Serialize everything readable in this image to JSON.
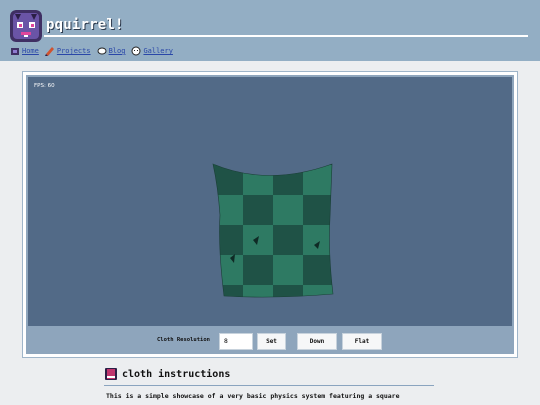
{
  "header": {
    "site_title": "pquirrel!",
    "logo_icon": "purple-squirrel-icon",
    "nav": [
      {
        "label": "Home",
        "icon": "home-icon"
      },
      {
        "label": "Projects",
        "icon": "pencil-icon"
      },
      {
        "label": "Blog",
        "icon": "leaf-icon"
      },
      {
        "label": "Gallery",
        "icon": "smiley-icon"
      }
    ]
  },
  "canvas": {
    "fps": "FPS: 60",
    "background": "#526a87",
    "cloth_colors": [
      "#2f7a63",
      "#1e4f44"
    ]
  },
  "controls": {
    "label": "Cloth Resolution",
    "resolution_value": "8",
    "set_label": "Set",
    "down_label": "Down",
    "flat_label": "Flat"
  },
  "section": {
    "title": "cloth instructions",
    "icon": "book-icon",
    "text": "This is a simple showcase of a very basic physics system featuring a square"
  }
}
